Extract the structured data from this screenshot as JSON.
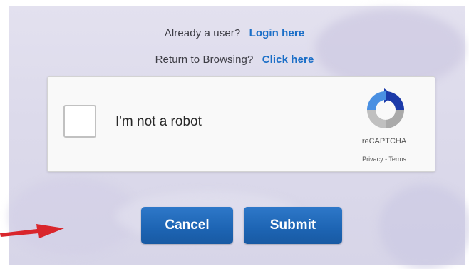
{
  "account": {
    "existing_user_prompt": "Already a user?",
    "login_link": "Login here",
    "browse_prompt": "Return to Browsing?",
    "browse_link": "Click here"
  },
  "recaptcha": {
    "checkbox_label": "I'm not a robot",
    "brand": "reCAPTCHA",
    "privacy_link": "Privacy",
    "separator": " - ",
    "terms_link": "Terms",
    "checked": false,
    "logo_icon": "recaptcha-logo-icon"
  },
  "actions": {
    "cancel_label": "Cancel",
    "submit_label": "Submit"
  },
  "annotation": {
    "arrow_icon": "red-arrow-icon",
    "arrow_color": "#d9262c"
  },
  "colors": {
    "link": "#1a6ec7",
    "button": "#1d64b3",
    "background": "#dcdaeb"
  }
}
